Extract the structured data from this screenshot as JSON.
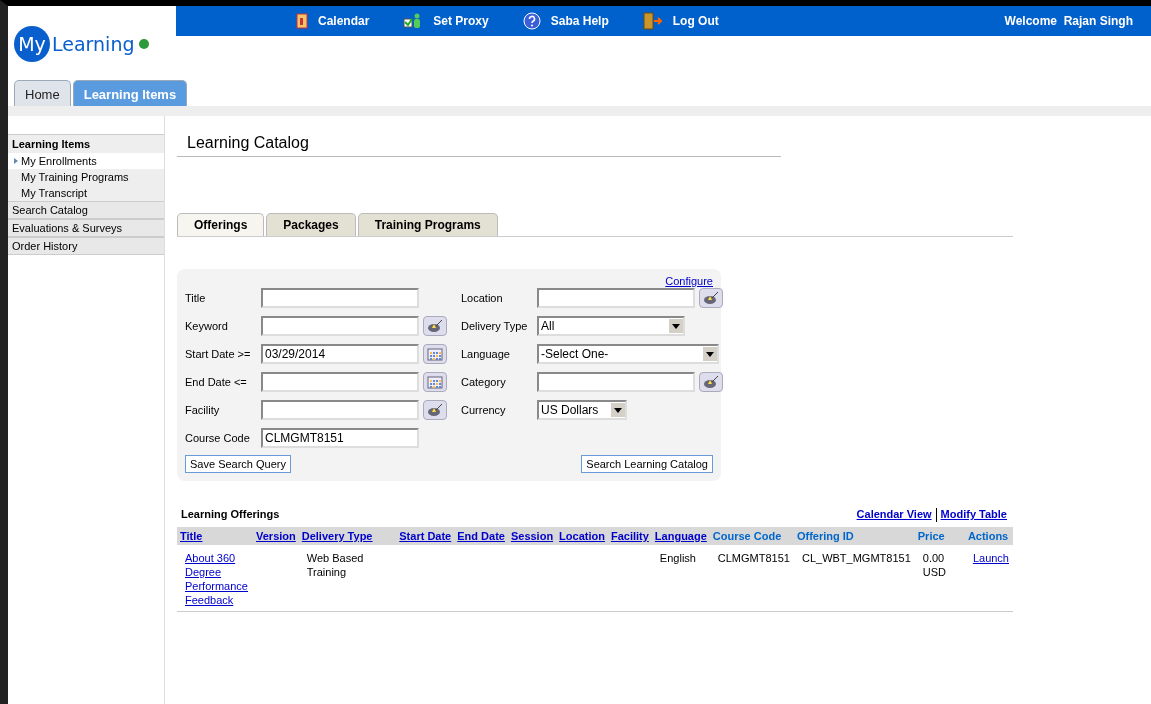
{
  "topbar": {
    "links": [
      {
        "kind": "calendar",
        "label": "Calendar"
      },
      {
        "kind": "proxy",
        "label": "Set Proxy"
      },
      {
        "kind": "help",
        "label": "Saba Help"
      },
      {
        "kind": "logout",
        "label": "Log Out"
      }
    ],
    "welcome": "Welcome  Rajan Singh"
  },
  "logo": {
    "part_1": "My",
    "part_2": "Learning"
  },
  "main_tabs": [
    {
      "label": "Home",
      "selected": false
    },
    {
      "label": "Learning Items",
      "selected": true
    }
  ],
  "sidebar": {
    "items": [
      {
        "label": "Learning Items",
        "children": [
          {
            "label": "My Enrollments",
            "selected": true
          },
          {
            "label": "My Training Programs",
            "selected": false
          },
          {
            "label": "My Transcript",
            "selected": false
          }
        ]
      },
      {
        "label": "Search Catalog"
      },
      {
        "label": "Evaluations & Surveys"
      },
      {
        "label": "Order History"
      }
    ]
  },
  "page_title": "Learning Catalog",
  "catalog_tabs": [
    {
      "label": "Offerings",
      "selected": true
    },
    {
      "label": "Packages",
      "selected": false
    },
    {
      "label": "Training Programs",
      "selected": false
    }
  ],
  "search_form": {
    "configure_link": "Configure",
    "left_fields": [
      {
        "label": "Title",
        "kind": "text"
      },
      {
        "label": "Keyword",
        "kind": "lookup"
      },
      {
        "label": "Start Date >=",
        "kind": "date",
        "value": "03/29/2014"
      },
      {
        "label": "End Date <=",
        "kind": "date"
      },
      {
        "label": "Facility",
        "kind": "lookup"
      },
      {
        "label": "Course Code",
        "kind": "text",
        "value": "CLMGMT8151"
      }
    ],
    "right_fields": [
      {
        "label": "Location",
        "kind": "lookup"
      },
      {
        "label": "Delivery Type",
        "kind": "select",
        "value": "All"
      },
      {
        "label": "Language",
        "kind": "select",
        "value": "-Select One-"
      },
      {
        "label": "Category",
        "kind": "lookup"
      },
      {
        "label": "Currency",
        "kind": "select",
        "value": "US Dollars"
      }
    ],
    "save_button": "Save Search Query",
    "search_button": "Search Learning Catalog"
  },
  "offerings": {
    "title": "Learning Offerings",
    "links": [
      "Calendar View",
      "Modify Table"
    ],
    "columns": [
      {
        "label": "Title",
        "link": true
      },
      {
        "label": "Version",
        "link": true
      },
      {
        "label": "Delivery Type",
        "link": true
      },
      {
        "label": "Start Date",
        "link": true
      },
      {
        "label": "End Date",
        "link": true
      },
      {
        "label": "Session",
        "link": true
      },
      {
        "label": "Location",
        "link": true
      },
      {
        "label": "Facility",
        "link": true
      },
      {
        "label": "Language",
        "link": true
      },
      {
        "label": "Course Code",
        "link": false
      },
      {
        "label": "Offering ID",
        "link": false
      },
      {
        "label": "Price",
        "link": false
      },
      {
        "label": "Actions",
        "link": false
      }
    ],
    "rows": [
      {
        "cells": [
          {
            "text": "About 360 Degree Performance Feedback",
            "link": true
          },
          null,
          {
            "text": "Web Based Training",
            "link": false
          },
          null,
          null,
          null,
          null,
          null,
          {
            "text": "English",
            "link": false
          },
          {
            "text": "CLMGMT8151",
            "link": false
          },
          {
            "text": "CL_WBT_MGMT8151",
            "link": false
          },
          {
            "text": "0.00 USD",
            "link": false
          },
          {
            "text": "Launch",
            "link": true
          }
        ]
      }
    ]
  }
}
